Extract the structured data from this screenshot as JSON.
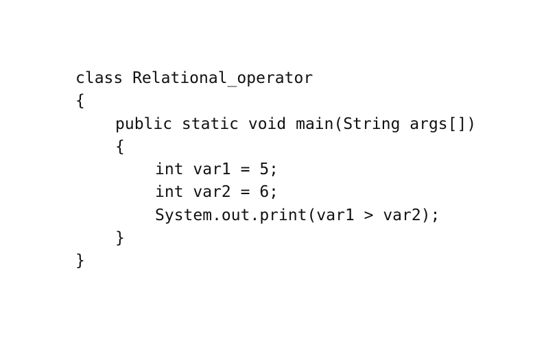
{
  "code": {
    "lines": [
      "class Relational_operator",
      "{",
      "public static void main(String args[])",
      "{",
      "int var1 = 5;",
      "int var2 = 6;",
      "System.out.print(var1 > var2);",
      "}",
      "}"
    ]
  }
}
